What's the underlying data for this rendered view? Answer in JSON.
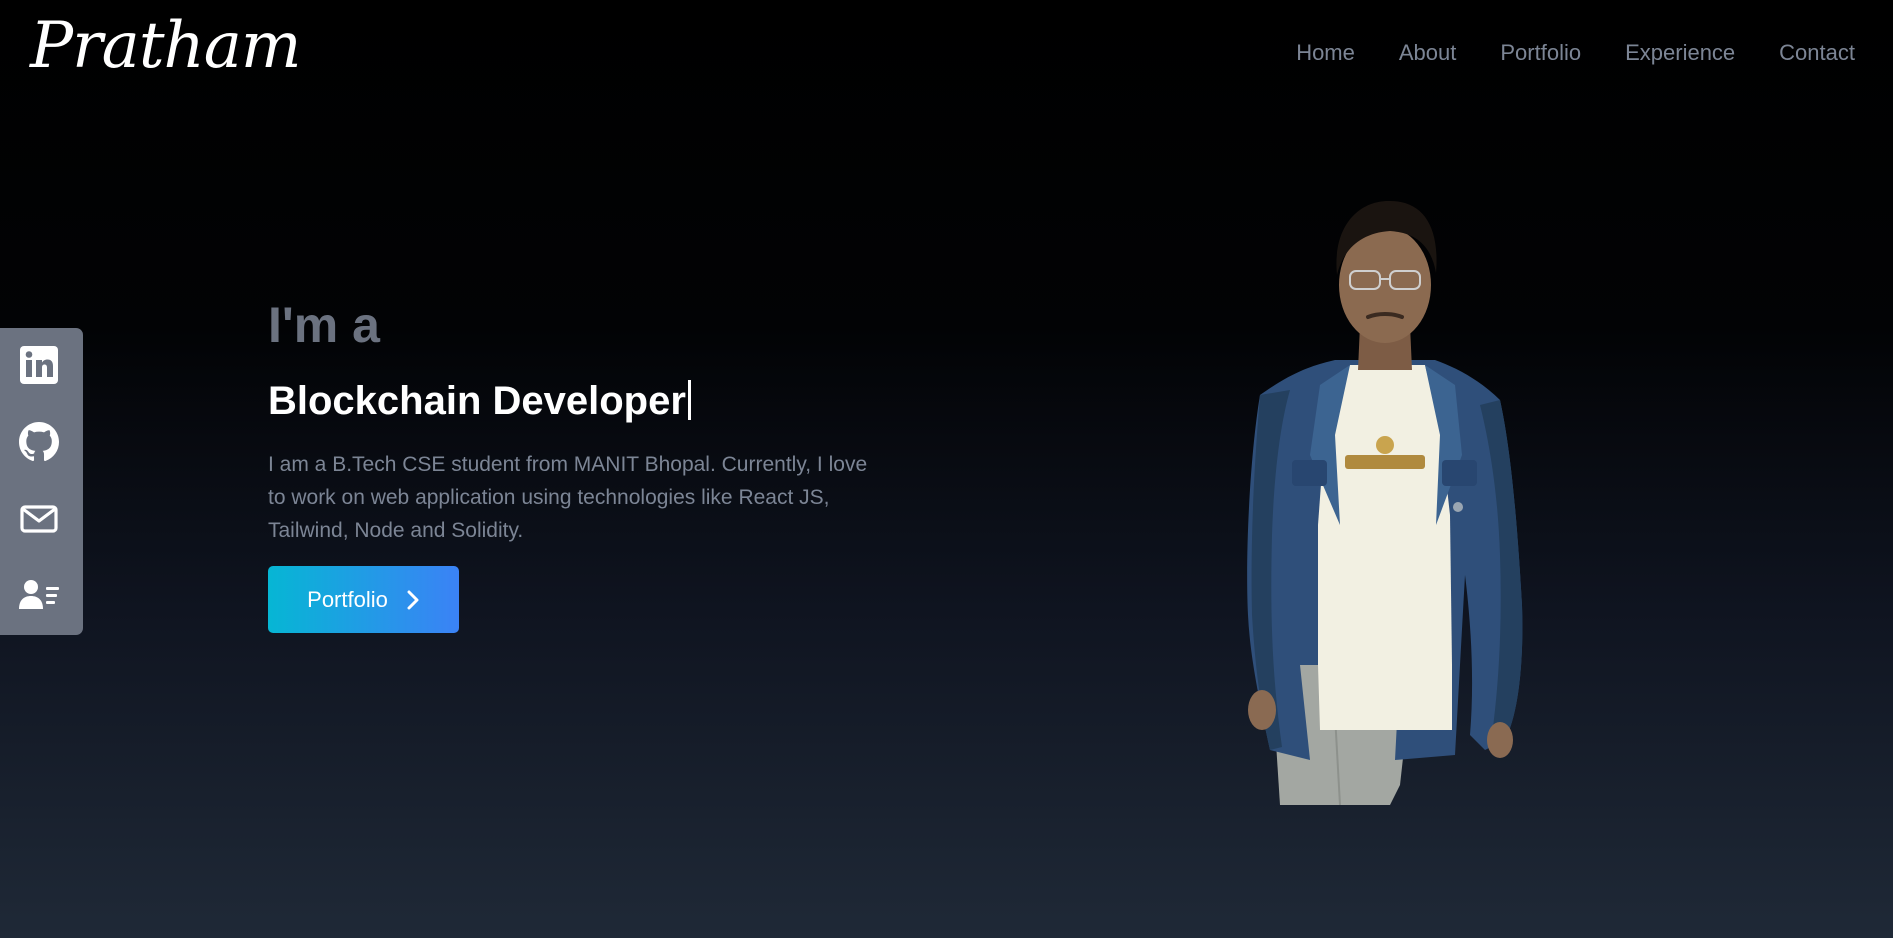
{
  "header": {
    "logo": "Pratham",
    "nav": [
      "Home",
      "About",
      "Portfolio",
      "Experience",
      "Contact"
    ]
  },
  "social": {
    "items": [
      {
        "icon": "linkedin-icon"
      },
      {
        "icon": "github-icon"
      },
      {
        "icon": "mail-icon"
      },
      {
        "icon": "resume-icon"
      }
    ]
  },
  "hero": {
    "intro": "I'm a",
    "role": "Blockchain Developer",
    "bio": "I am a B.Tech CSE student from MANIT Bhopal. Currently, I love to work on web application using technologies like React JS, Tailwind, Node and Solidity.",
    "cta_label": "Portfolio"
  },
  "colors": {
    "accent_start": "#06b6d4",
    "accent_end": "#3b82f6",
    "muted_text": "#7c8595",
    "sidebar_bg": "#6b7280"
  }
}
